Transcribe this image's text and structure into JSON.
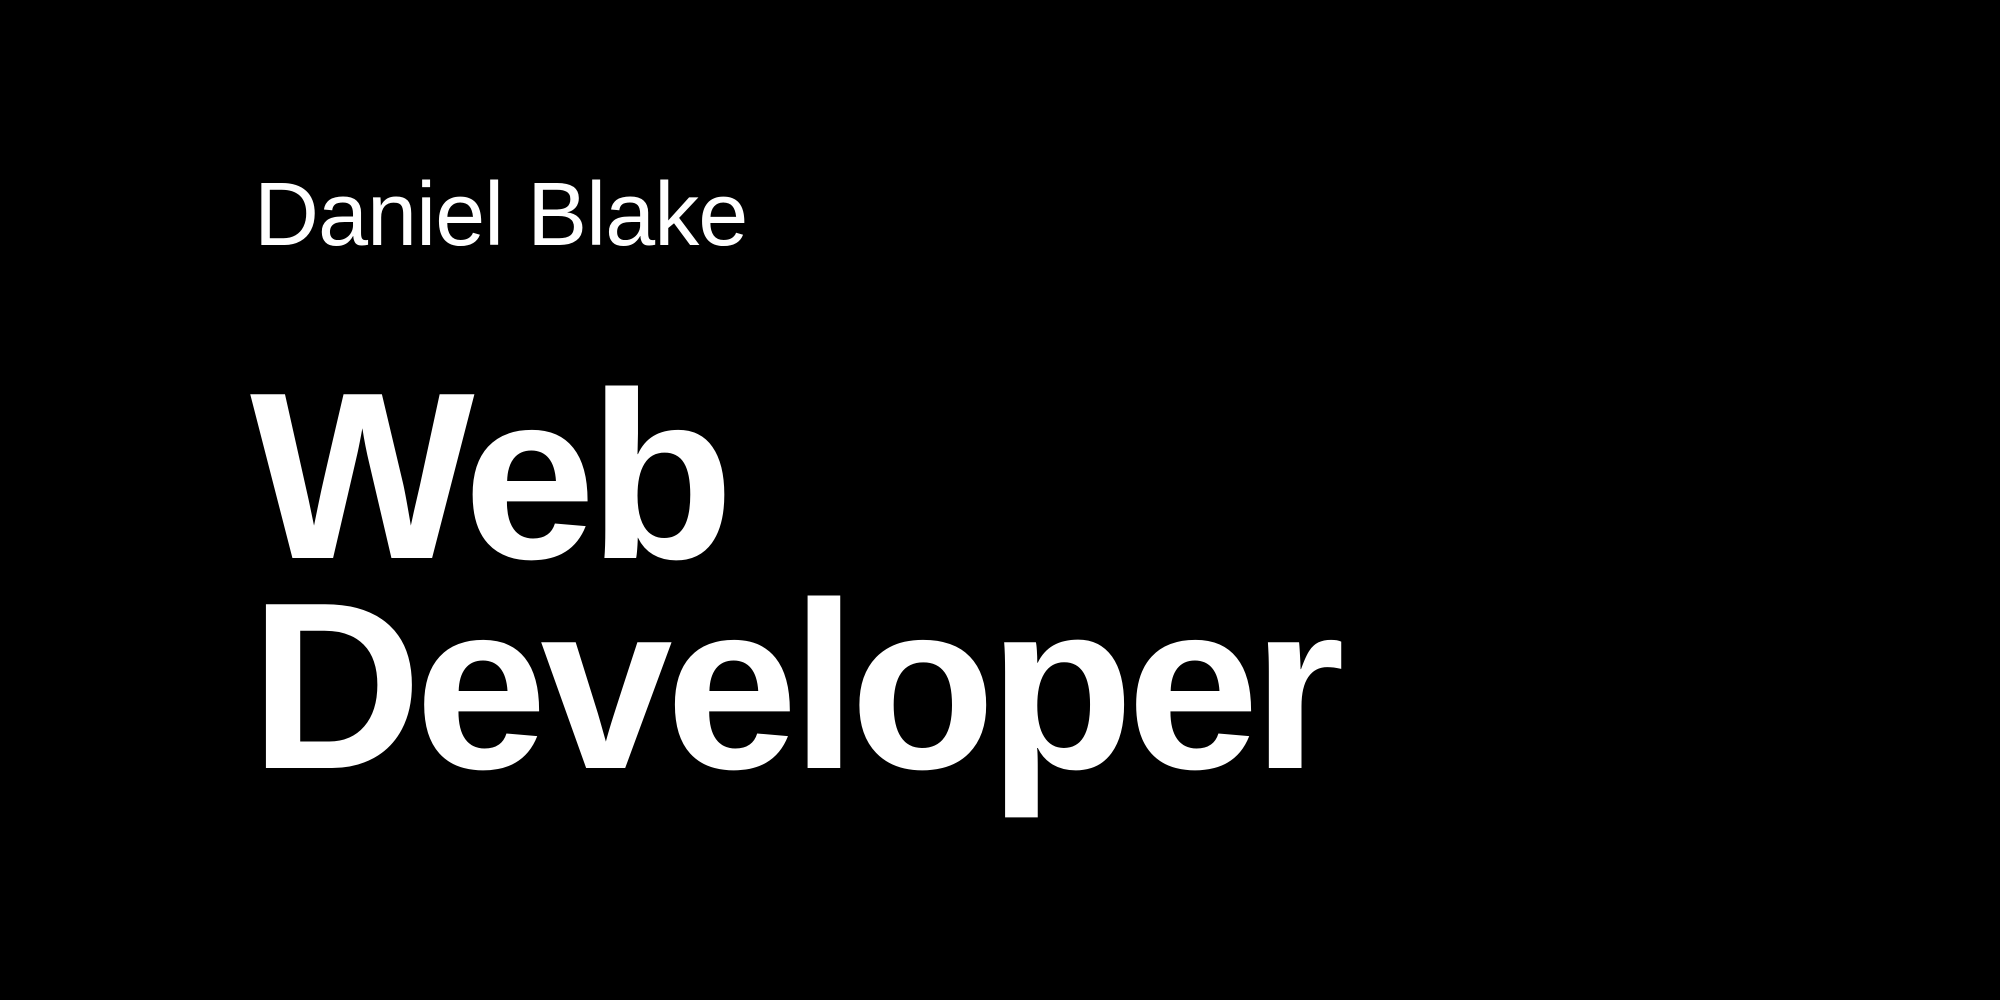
{
  "page": {
    "background": "#000000",
    "text_color": "#ffffff"
  },
  "hero": {
    "name": "Daniel Blake",
    "role_line_1": "Web",
    "role_line_2": "Developer"
  }
}
